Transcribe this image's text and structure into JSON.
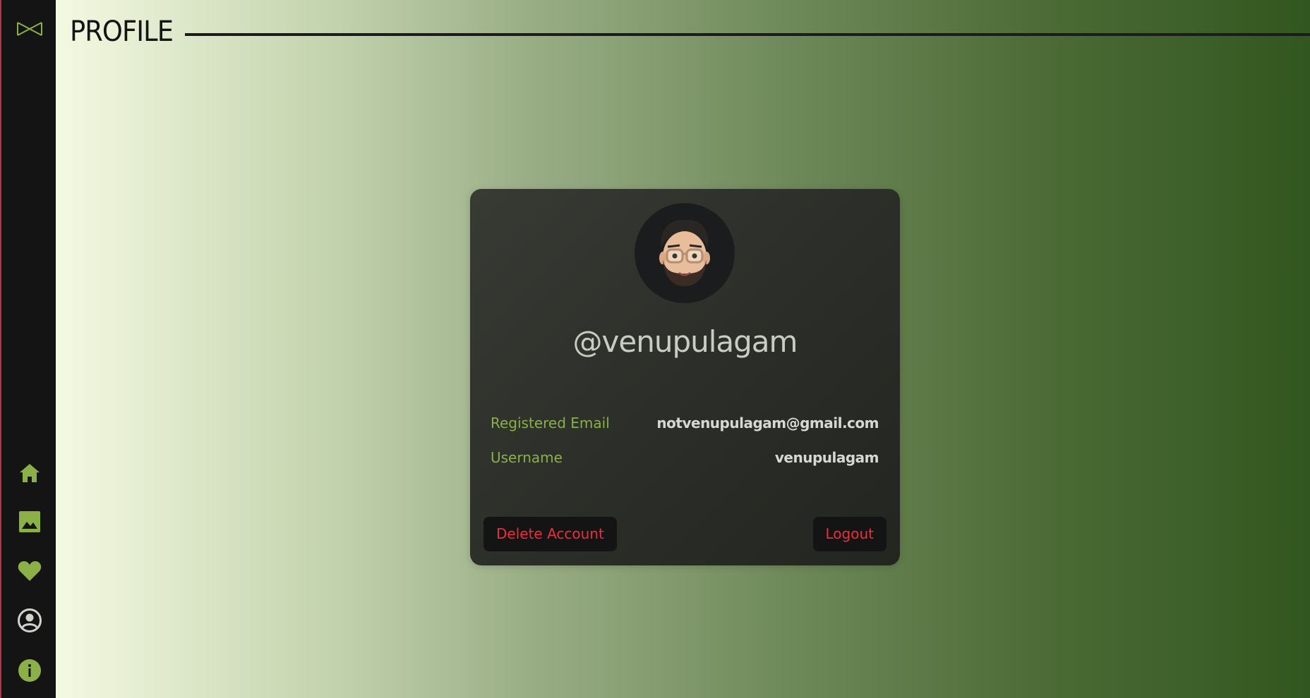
{
  "sidebar": {
    "logo_icon": "bowtie-logo-icon",
    "items": [
      {
        "name": "home",
        "icon": "home-icon"
      },
      {
        "name": "gallery",
        "icon": "image-icon"
      },
      {
        "name": "favorites",
        "icon": "heart-icon"
      },
      {
        "name": "profile",
        "icon": "user-circle-icon"
      },
      {
        "name": "info",
        "icon": "info-icon"
      }
    ],
    "accent_color": "#8bb048"
  },
  "header": {
    "title": "PROFILE"
  },
  "profile": {
    "handle": "@venupulagam",
    "details": [
      {
        "label": "Registered Email",
        "value": "notvenupulagam@gmail.com"
      },
      {
        "label": "Username",
        "value": "venupulagam"
      }
    ],
    "delete_label": "Delete Account",
    "logout_label": "Logout",
    "danger_color": "#ef2e3b"
  }
}
